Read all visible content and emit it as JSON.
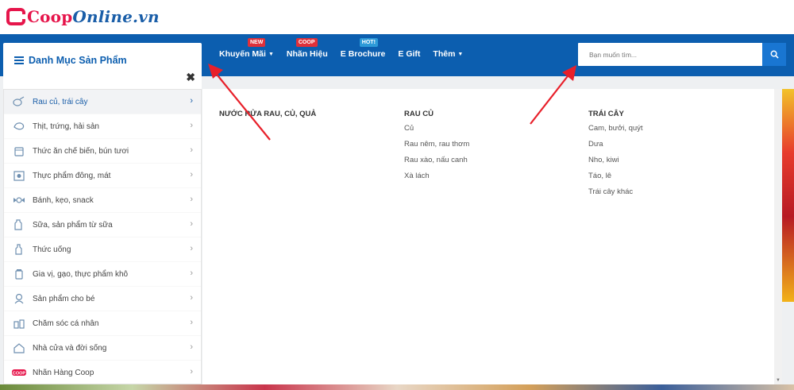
{
  "logo": {
    "part1": "Coop",
    "part2": "Online.vn"
  },
  "category_button": {
    "label": "Danh Mục Sản Phẩm"
  },
  "nav": [
    {
      "label": "Khuyến Mãi",
      "badge": "NEW",
      "caret": true
    },
    {
      "label": "Nhãn Hiệu",
      "badge": "COOP",
      "caret": false
    },
    {
      "label": "E Brochure",
      "badge": "HOT!",
      "caret": false
    },
    {
      "label": "E Gift",
      "badge": "",
      "caret": false
    },
    {
      "label": "Thêm",
      "badge": "",
      "caret": true
    }
  ],
  "search": {
    "placeholder": "Bạn muốn tìm..."
  },
  "sidebar": {
    "items": [
      {
        "label": "Rau củ, trái cây",
        "icon": "vegetable-icon"
      },
      {
        "label": "Thịt, trứng, hải sản",
        "icon": "meat-icon"
      },
      {
        "label": "Thức ăn chế biến, bún tươi",
        "icon": "prepared-food-icon"
      },
      {
        "label": "Thực phẩm đông, mát",
        "icon": "fridge-icon"
      },
      {
        "label": "Bánh, kẹo, snack",
        "icon": "candy-icon"
      },
      {
        "label": "Sữa, sản phẩm từ sữa",
        "icon": "milk-icon"
      },
      {
        "label": "Thức uống",
        "icon": "drink-icon"
      },
      {
        "label": "Gia vị, gạo, thực phẩm khô",
        "icon": "spice-icon"
      },
      {
        "label": "Sản phẩm cho bé",
        "icon": "baby-icon"
      },
      {
        "label": "Chăm sóc cá nhân",
        "icon": "personal-care-icon"
      },
      {
        "label": "Nhà cửa và đời sống",
        "icon": "home-icon"
      },
      {
        "label": "Nhãn Hàng Coop",
        "icon": "coop-brand-icon"
      }
    ]
  },
  "mega_menu": {
    "columns": [
      {
        "title": "NƯỚC RỬA RAU, CỦ, QUẢ",
        "links": []
      },
      {
        "title": "RAU CỦ",
        "links": [
          "Củ",
          "Rau nêm, rau thơm",
          "Rau xào, nấu canh",
          "Xà lách"
        ]
      },
      {
        "title": "TRÁI CÂY",
        "links": [
          "Cam, bưởi, quýt",
          "Dưa",
          "Nho, kiwi",
          "Táo, lê",
          "Trái cây khác"
        ]
      }
    ]
  },
  "colors": {
    "brand_pink": "#e6154b",
    "nav_blue": "#0c5eaf",
    "annotation_red": "#e8202a"
  }
}
